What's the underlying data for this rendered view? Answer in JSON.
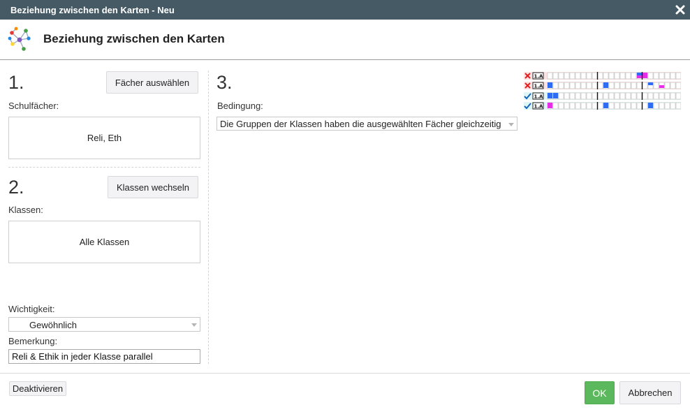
{
  "window": {
    "title": "Beziehung zwischen den Karten - Neu"
  },
  "header": {
    "title": "Beziehung zwischen den Karten",
    "icon": "network-relation-icon"
  },
  "step1": {
    "number": "1.",
    "button": "Fächer auswählen",
    "label": "Schulfächer:",
    "value": "Reli, Eth"
  },
  "step2": {
    "number": "2.",
    "button": "Klassen wechseln",
    "label": "Klassen:",
    "value": "Alle Klassen"
  },
  "importance": {
    "label": "Wichtigkeit:",
    "value": "Gewöhnlich"
  },
  "remark": {
    "label": "Bemerkung:",
    "value": "Reli & Ethik in jeder Klasse parallel"
  },
  "step3": {
    "number": "3.",
    "label": "Bedingung:",
    "condition": "Die Gruppen der Klassen haben die ausgewählten Fächer gleichzeitig"
  },
  "preview": {
    "rows": [
      {
        "status": "invalid",
        "tag": "1.A"
      },
      {
        "status": "invalid",
        "tag": "1.A"
      },
      {
        "status": "valid",
        "tag": "1.A"
      },
      {
        "status": "valid",
        "tag": "1.A"
      }
    ],
    "colors": {
      "invalid_bg": "#fbe3e3",
      "valid_bg": "#e0f6f6",
      "blue": "#2e6cf2",
      "magenta": "#e62ee6",
      "cross": "#e02020",
      "check": "#1565c0"
    }
  },
  "footer": {
    "deactivate": "Deaktivieren",
    "ok": "OK",
    "cancel": "Abbrechen"
  },
  "colors": {
    "titlebar": "#455a64",
    "ok": "#5cb85c"
  }
}
